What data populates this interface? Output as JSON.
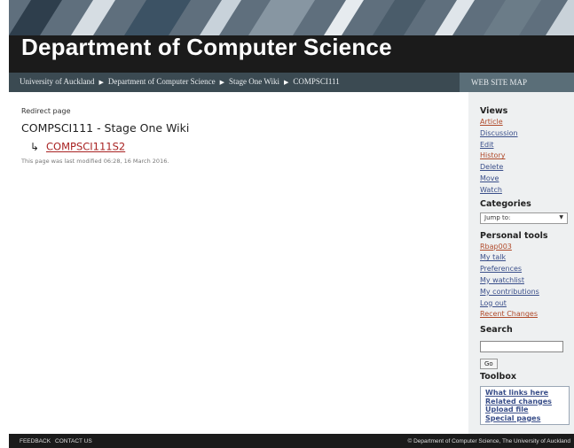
{
  "banner": {
    "title": "Department of Computer Science"
  },
  "breadcrumbs": [
    "University of Auckland",
    "Department of Computer Science",
    "Stage One Wiki",
    "COMPSCI111"
  ],
  "site_map_label": "WEB SITE MAP",
  "content": {
    "redirect_label": "Redirect page",
    "heading": "COMPSCI111 - Stage One Wiki",
    "redirect_arrow": "↳",
    "redirect_target": "COMPSCI111S2",
    "last_modified": "This page was last modified 06:28, 16 March 2016."
  },
  "sidebar": {
    "views_heading": "Views",
    "views": [
      "Article",
      "Discussion",
      "Edit",
      "History",
      "Delete",
      "Move",
      "Watch"
    ],
    "categories_heading": "Categories",
    "jump_label": "Jump to:",
    "personal_heading": "Personal tools",
    "personal": [
      "Rbap003",
      "My talk",
      "Preferences",
      "My watchlist",
      "My contributions",
      "Log out",
      "Recent Changes"
    ],
    "search_heading": "Search",
    "go_label": "Go",
    "toolbox_heading": "Toolbox",
    "toolbox": [
      "What links here",
      "Related changes",
      "Upload file",
      "Special pages"
    ]
  },
  "footer": {
    "links": [
      "FEEDBACK",
      "CONTACT US"
    ],
    "copyright": "© Department of Computer Science, The University of Auckland"
  },
  "colors": {
    "banner_bg": "#1b1b1b",
    "breadcrumb_bar": "#3b4a52",
    "link": "#3a4f8a",
    "accent_red": "#a82222"
  }
}
